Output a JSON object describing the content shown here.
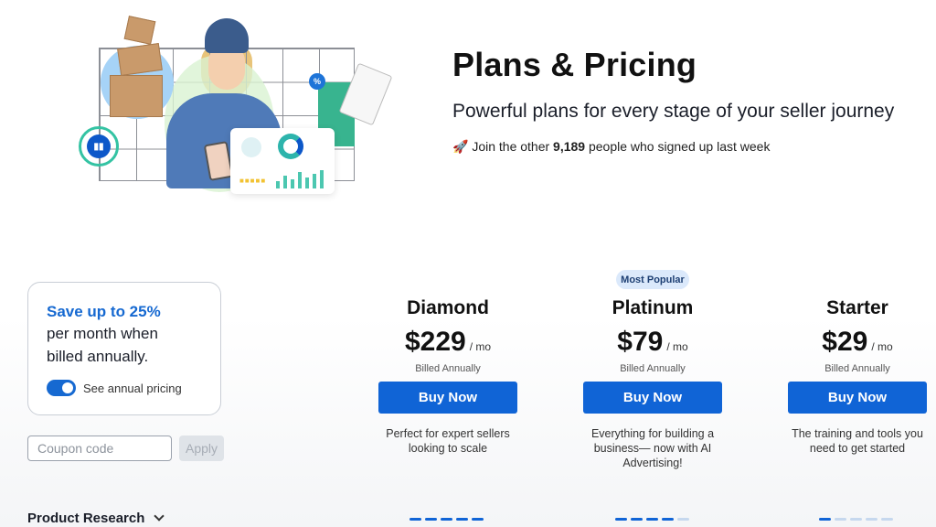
{
  "header": {
    "title": "Plans & Pricing",
    "subtitle": "Powerful plans for every stage of your seller journey",
    "signup_prefix": "🚀 Join the other ",
    "signup_count": "9,189",
    "signup_suffix": " people who signed up last week"
  },
  "savings_card": {
    "headline": "Save up to 25%",
    "line1": "per month when",
    "line2": "billed annually.",
    "toggle_label": "See annual pricing",
    "toggle_on": true
  },
  "coupon": {
    "placeholder": "Coupon code",
    "value": "",
    "apply_label": "Apply"
  },
  "section": {
    "label": "Product Research"
  },
  "badge": {
    "label": "Most Popular"
  },
  "plans": [
    {
      "name": "Diamond",
      "price": "$229",
      "per": "/ mo",
      "billing": "Billed Annually",
      "button": "Buy Now",
      "description": "Perfect for expert sellers looking to scale"
    },
    {
      "name": "Platinum",
      "price": "$79",
      "per": "/ mo",
      "billing": "Billed Annually",
      "button": "Buy Now",
      "description": "Everything for building a business— now with AI Advertising!"
    },
    {
      "name": "Starter",
      "price": "$29",
      "per": "/ mo",
      "billing": "Billed Annually",
      "button": "Buy Now",
      "description": "The training and tools you need to get started"
    }
  ],
  "colors": {
    "accent": "#1064d6",
    "headline_blue": "#1669d1",
    "badge_bg": "#dbe9fb"
  },
  "icons": [
    "box-icon",
    "chart-icon",
    "percent-icon",
    "clipboard-icon",
    "chevron-down-icon",
    "rocket-icon"
  ]
}
